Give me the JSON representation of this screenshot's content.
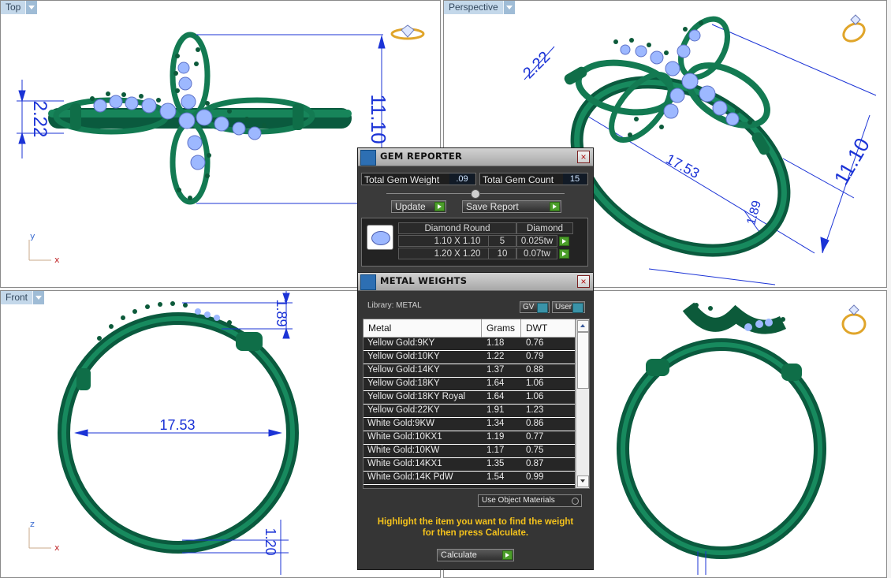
{
  "viewports": {
    "top": {
      "label": "Top",
      "dims": [
        "2.22",
        "11.10"
      ],
      "axis_y": "y",
      "axis_x": "x"
    },
    "perspective": {
      "label": "Perspective",
      "dims": [
        "2.22",
        "17.53",
        "1.89",
        "11.10"
      ]
    },
    "front": {
      "label": "Front",
      "dims": [
        "1.89",
        "17.53",
        "1.20"
      ],
      "axis_z": "z",
      "axis_x": "x"
    },
    "right": {
      "label": ""
    }
  },
  "gem_reporter": {
    "title": "GEM REPORTER",
    "close": "×",
    "total_weight_label": "Total Gem Weight",
    "total_weight_value": ".09",
    "total_count_label": "Total Gem Count",
    "total_count_value": "15",
    "update_label": "Update",
    "save_report_label": "Save Report",
    "table": {
      "shape": "Diamond Round",
      "material": "Diamond",
      "rows": [
        {
          "size": "1.10 X 1.10",
          "count": "5",
          "weight": "0.025tw"
        },
        {
          "size": "1.20 X 1.20",
          "count": "10",
          "weight": "0.07tw"
        }
      ]
    }
  },
  "metal_weights": {
    "title": "METAL WEIGHTS",
    "close": "×",
    "library_label": "Library: METAL",
    "gv_label": "GV",
    "user_label": "User",
    "columns": [
      "Metal",
      "Grams",
      "DWT"
    ],
    "rows": [
      {
        "metal": "Yellow Gold:9KY",
        "grams": "1.18",
        "dwt": "0.76"
      },
      {
        "metal": "Yellow Gold:10KY",
        "grams": "1.22",
        "dwt": "0.79"
      },
      {
        "metal": "Yellow Gold:14KY",
        "grams": "1.37",
        "dwt": "0.88"
      },
      {
        "metal": "Yellow Gold:18KY",
        "grams": "1.64",
        "dwt": "1.06"
      },
      {
        "metal": "Yellow Gold:18KY Royal",
        "grams": "1.64",
        "dwt": "1.06"
      },
      {
        "metal": "Yellow Gold:22KY",
        "grams": "1.91",
        "dwt": "1.23"
      },
      {
        "metal": "White Gold:9KW",
        "grams": "1.34",
        "dwt": "0.86"
      },
      {
        "metal": "White Gold:10KX1",
        "grams": "1.19",
        "dwt": "0.77"
      },
      {
        "metal": "White Gold:10KW",
        "grams": "1.17",
        "dwt": "0.75"
      },
      {
        "metal": "White Gold:14KX1",
        "grams": "1.35",
        "dwt": "0.87"
      },
      {
        "metal": "White Gold:14K PdW",
        "grams": "1.54",
        "dwt": "0.99"
      }
    ],
    "use_object_materials": "Use Object Materials",
    "hint": "Highlight the item you want to find the weight for then press Calculate.",
    "calculate_label": "Calculate"
  }
}
